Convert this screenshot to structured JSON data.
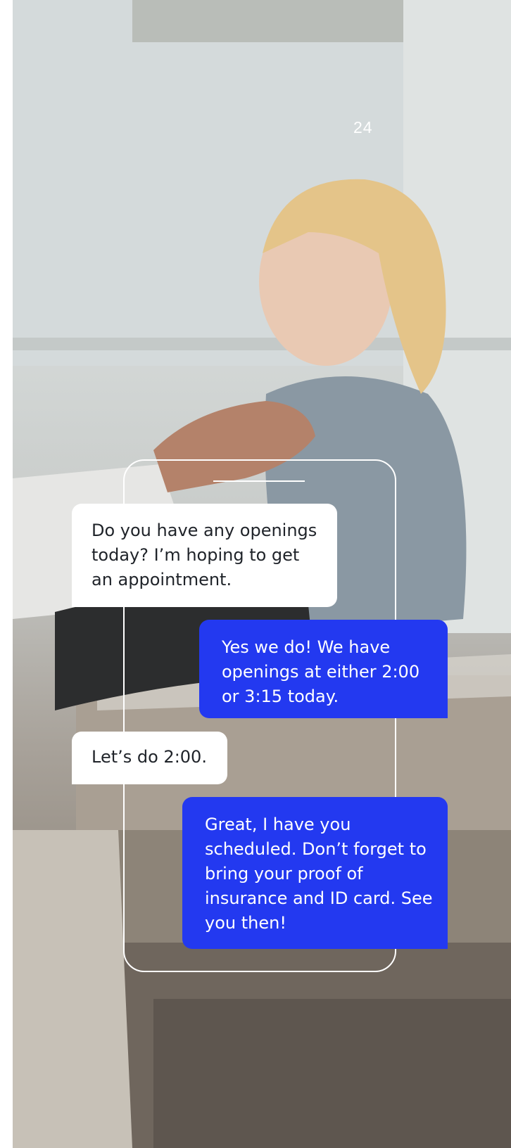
{
  "page": {
    "number": "24"
  },
  "chat": {
    "messages": [
      {
        "sender": "patient",
        "text": "Do you have any openings today? I’m hoping to get an appointment."
      },
      {
        "sender": "office",
        "text": "Yes we do! We have openings at either 2:00 or 3:15 today."
      },
      {
        "sender": "patient",
        "text": "Let’s do 2:00."
      },
      {
        "sender": "office",
        "text": "Great, I have you scheduled. Don’t forget to bring your proof of insurance and ID card. See you then!"
      }
    ]
  },
  "colors": {
    "outgoing_bubble": "#2339f0",
    "incoming_bubble": "#ffffff",
    "incoming_text": "#1f2329",
    "frame": "#ffffff"
  }
}
